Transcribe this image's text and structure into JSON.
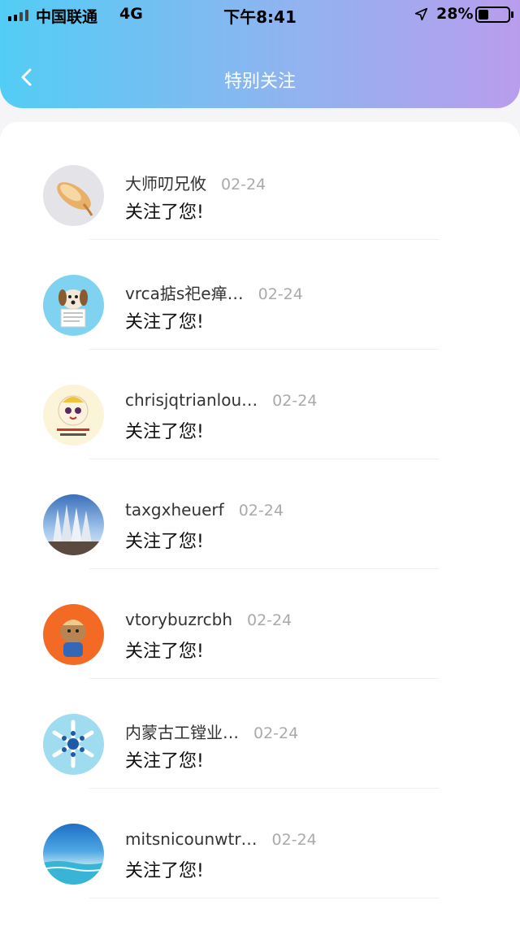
{
  "status_bar": {
    "carrier": "中国联通",
    "network": "4G",
    "time": "下午8:41",
    "battery_percent": "28%"
  },
  "nav": {
    "title": "特别关注",
    "back_icon": "chevron-left-icon"
  },
  "colors": {
    "header_gradient_start": "#52cdf5",
    "header_gradient_end": "#b99ded",
    "date_color": "#aaaaaa"
  },
  "follows": [
    {
      "name": "大师叨兄攸",
      "date": "02-24",
      "message": "关注了您!"
    },
    {
      "name": "vrca掂s祀e瘅…",
      "date": "02-24",
      "message": "关注了您!"
    },
    {
      "name": "chrisjqtrianlou…",
      "date": "02-24",
      "message": "关注了您!"
    },
    {
      "name": "taxgxheuerf",
      "date": "02-24",
      "message": "关注了您!"
    },
    {
      "name": "vtorybuzrcbh",
      "date": "02-24",
      "message": "关注了您!"
    },
    {
      "name": "内蒙古工镗业…",
      "date": "02-24",
      "message": "关注了您!"
    },
    {
      "name": "mitsnicounwtr…",
      "date": "02-24",
      "message": "关注了您!"
    }
  ]
}
